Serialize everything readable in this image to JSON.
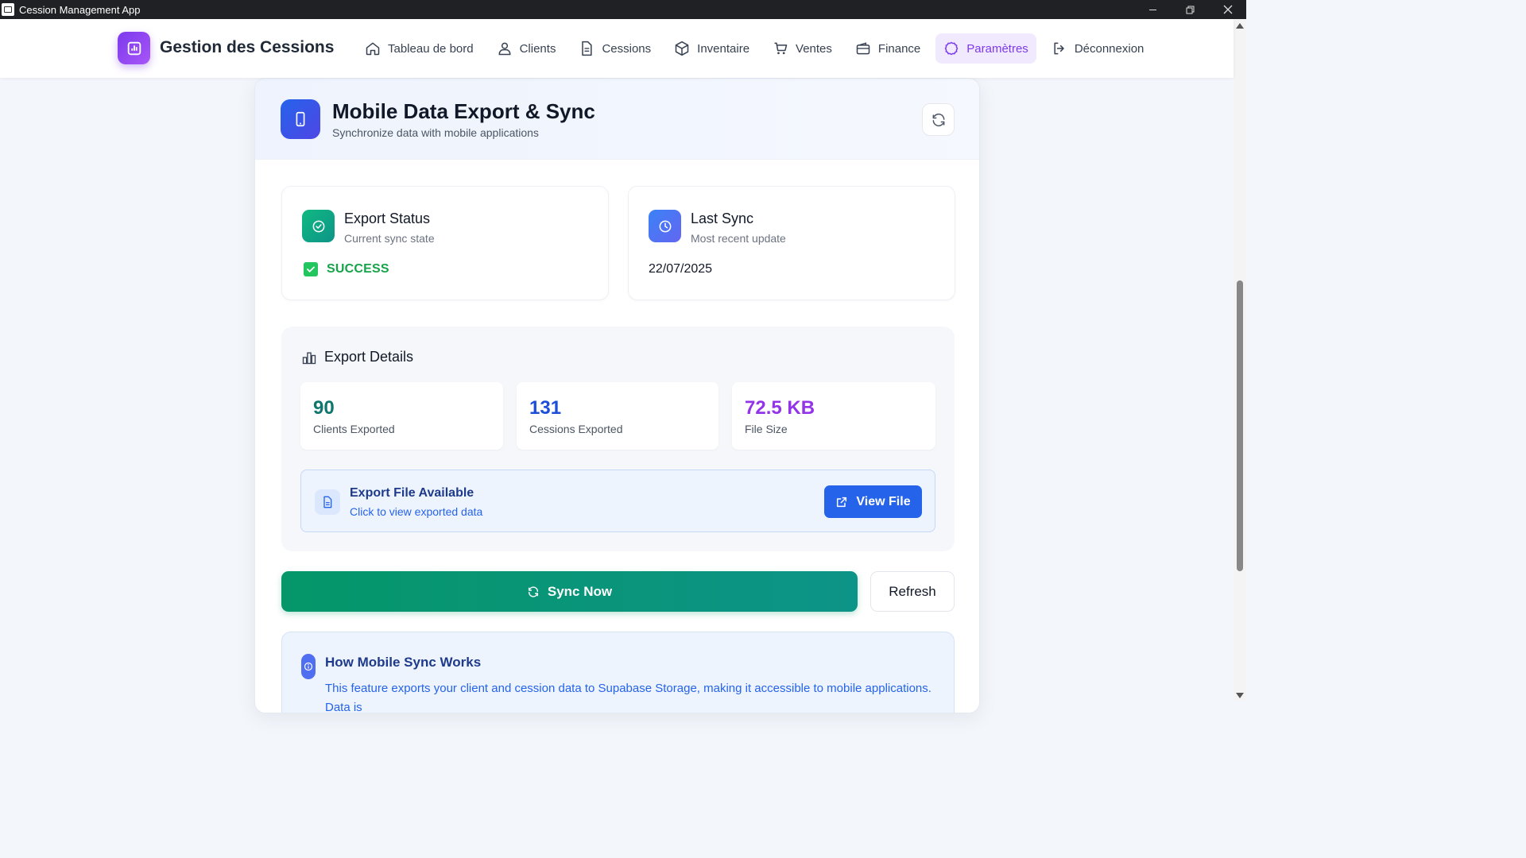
{
  "window": {
    "title": "Cession Management App"
  },
  "header": {
    "brand": "Gestion des Cessions",
    "nav": [
      {
        "label": "Tableau de bord",
        "icon": "home-icon",
        "active": false
      },
      {
        "label": "Clients",
        "icon": "users-icon",
        "active": false
      },
      {
        "label": "Cessions",
        "icon": "document-icon",
        "active": false
      },
      {
        "label": "Inventaire",
        "icon": "box-icon",
        "active": false
      },
      {
        "label": "Ventes",
        "icon": "cart-icon",
        "active": false
      },
      {
        "label": "Finance",
        "icon": "wallet-icon",
        "active": true
      },
      {
        "label": "Paramètres",
        "icon": "settings-icon",
        "active": true
      },
      {
        "label": "Déconnexion",
        "icon": "logout-icon",
        "active": false
      }
    ]
  },
  "page": {
    "title": "Mobile Data Export & Sync",
    "subtitle": "Synchronize data with mobile applications"
  },
  "export_status": {
    "title": "Export Status",
    "subtitle": "Current sync state",
    "value": "SUCCESS"
  },
  "last_sync": {
    "title": "Last Sync",
    "subtitle": "Most recent update",
    "value": "22/07/2025"
  },
  "details": {
    "title": "Export Details",
    "metrics": [
      {
        "value": "90",
        "label": "Clients Exported",
        "color": "#0f766e"
      },
      {
        "value": "131",
        "label": "Cessions Exported",
        "color": "#1d4ed8"
      },
      {
        "value": "72.5 KB",
        "label": "File Size",
        "color": "#9333ea"
      }
    ],
    "file": {
      "title": "Export File Available",
      "subtitle": "Click to view exported data",
      "button": "View File"
    }
  },
  "actions": {
    "sync": "Sync Now",
    "refresh": "Refresh"
  },
  "info": {
    "title": "How Mobile Sync Works",
    "text": "This feature exports your client and cession data to Supabase Storage, making it accessible to mobile applications. Data is"
  },
  "colors": {
    "accent": "#7c3aed",
    "primary": "#2563eb",
    "success": "#16a34a",
    "sync": "#059669"
  }
}
